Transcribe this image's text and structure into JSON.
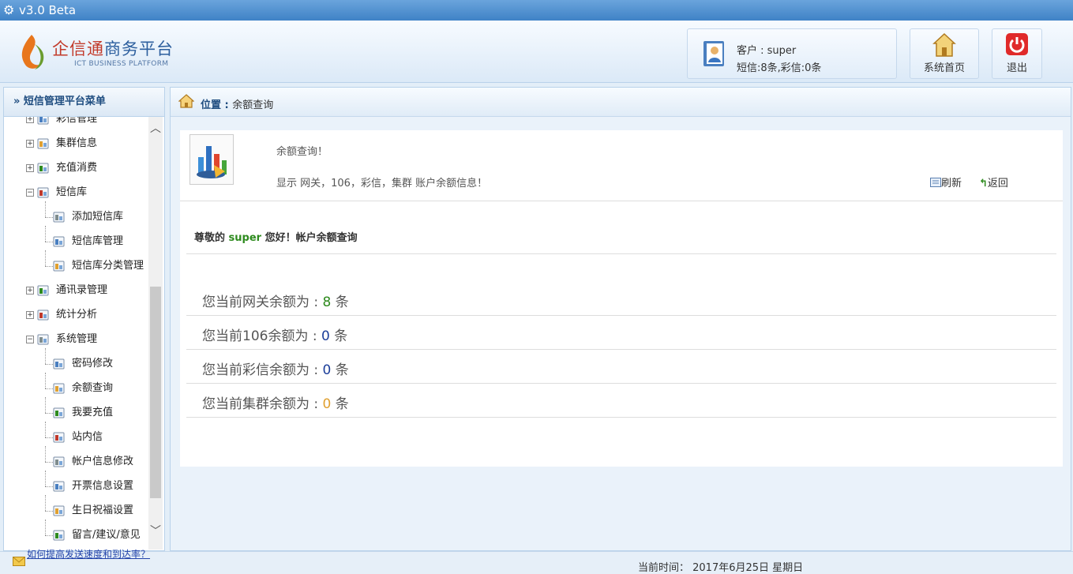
{
  "window": {
    "title": "v3.0  Beta"
  },
  "brand": {
    "name_red": "企信通",
    "name_blue": "商务平台",
    "subtitle": "ICT BUSINESS PLATFORM"
  },
  "user_panel": {
    "customer_line": "客户 : super",
    "balance_line": "短信:8条,彩信:0条"
  },
  "header_buttons": {
    "home": "系统首页",
    "exit": "退出"
  },
  "sidebar": {
    "title": "» 短信管理平台菜单",
    "items": [
      {
        "label": "彩信管理",
        "level": 0,
        "expander": "+",
        "icon": "mms-icon"
      },
      {
        "label": "集群信息",
        "level": 0,
        "expander": "+",
        "icon": "cluster-icon"
      },
      {
        "label": "充值消费",
        "level": 0,
        "expander": "+",
        "icon": "recharge-icon"
      },
      {
        "label": "短信库",
        "level": 0,
        "expander": "−",
        "icon": "library-icon"
      },
      {
        "label": "添加短信库",
        "level": 1,
        "icon": "add-icon"
      },
      {
        "label": "短信库管理",
        "level": 1,
        "icon": "list-icon"
      },
      {
        "label": "短信库分类管理",
        "level": 1,
        "icon": "category-icon"
      },
      {
        "label": "通讯录管理",
        "level": 0,
        "expander": "+",
        "icon": "contacts-icon"
      },
      {
        "label": "统计分析",
        "level": 0,
        "expander": "+",
        "icon": "stats-icon"
      },
      {
        "label": "系统管理",
        "level": 0,
        "expander": "−",
        "icon": "settings-icon"
      },
      {
        "label": "密码修改",
        "level": 1,
        "icon": "password-icon"
      },
      {
        "label": "余额查询",
        "level": 1,
        "icon": "balance-icon"
      },
      {
        "label": "我要充值",
        "level": 1,
        "icon": "topup-icon"
      },
      {
        "label": "站内信",
        "level": 1,
        "icon": "book-icon"
      },
      {
        "label": "帐户信息修改",
        "level": 1,
        "icon": "account-icon"
      },
      {
        "label": "开票信息设置",
        "level": 1,
        "icon": "invoice-icon"
      },
      {
        "label": "生日祝福设置",
        "level": 1,
        "icon": "birthday-icon"
      },
      {
        "label": "留言/建议/意见",
        "level": 1,
        "icon": "message-icon"
      }
    ]
  },
  "location": {
    "prefix": "位置 : ",
    "current": "余额查询"
  },
  "intro": {
    "title": "余额查询！",
    "desc": "显示 网关，106，彩信，集群 账户余额信息！"
  },
  "actions": {
    "refresh": "刷新",
    "back": "返回"
  },
  "greeting": {
    "before": "尊敬的 ",
    "user": "super",
    "after": " 您好！帐户余额查询"
  },
  "balances": [
    {
      "label": "您当前网关余额为 : ",
      "value": "8",
      "unit": " 条",
      "color": "#2e8b1e"
    },
    {
      "label": "您当前106余额为 : ",
      "value": "0",
      "unit": " 条",
      "color": "#1d3f9a"
    },
    {
      "label": "您当前彩信余额为 : ",
      "value": "0",
      "unit": " 条",
      "color": "#1d3f9a"
    },
    {
      "label": "您当前集群余额为 : ",
      "value": "0",
      "unit": " 条",
      "color": "#e0a030"
    }
  ],
  "footer": {
    "link": "如何提高发送速度和到达率？",
    "time": "当前时间： 2017年6月25日 星期日"
  }
}
